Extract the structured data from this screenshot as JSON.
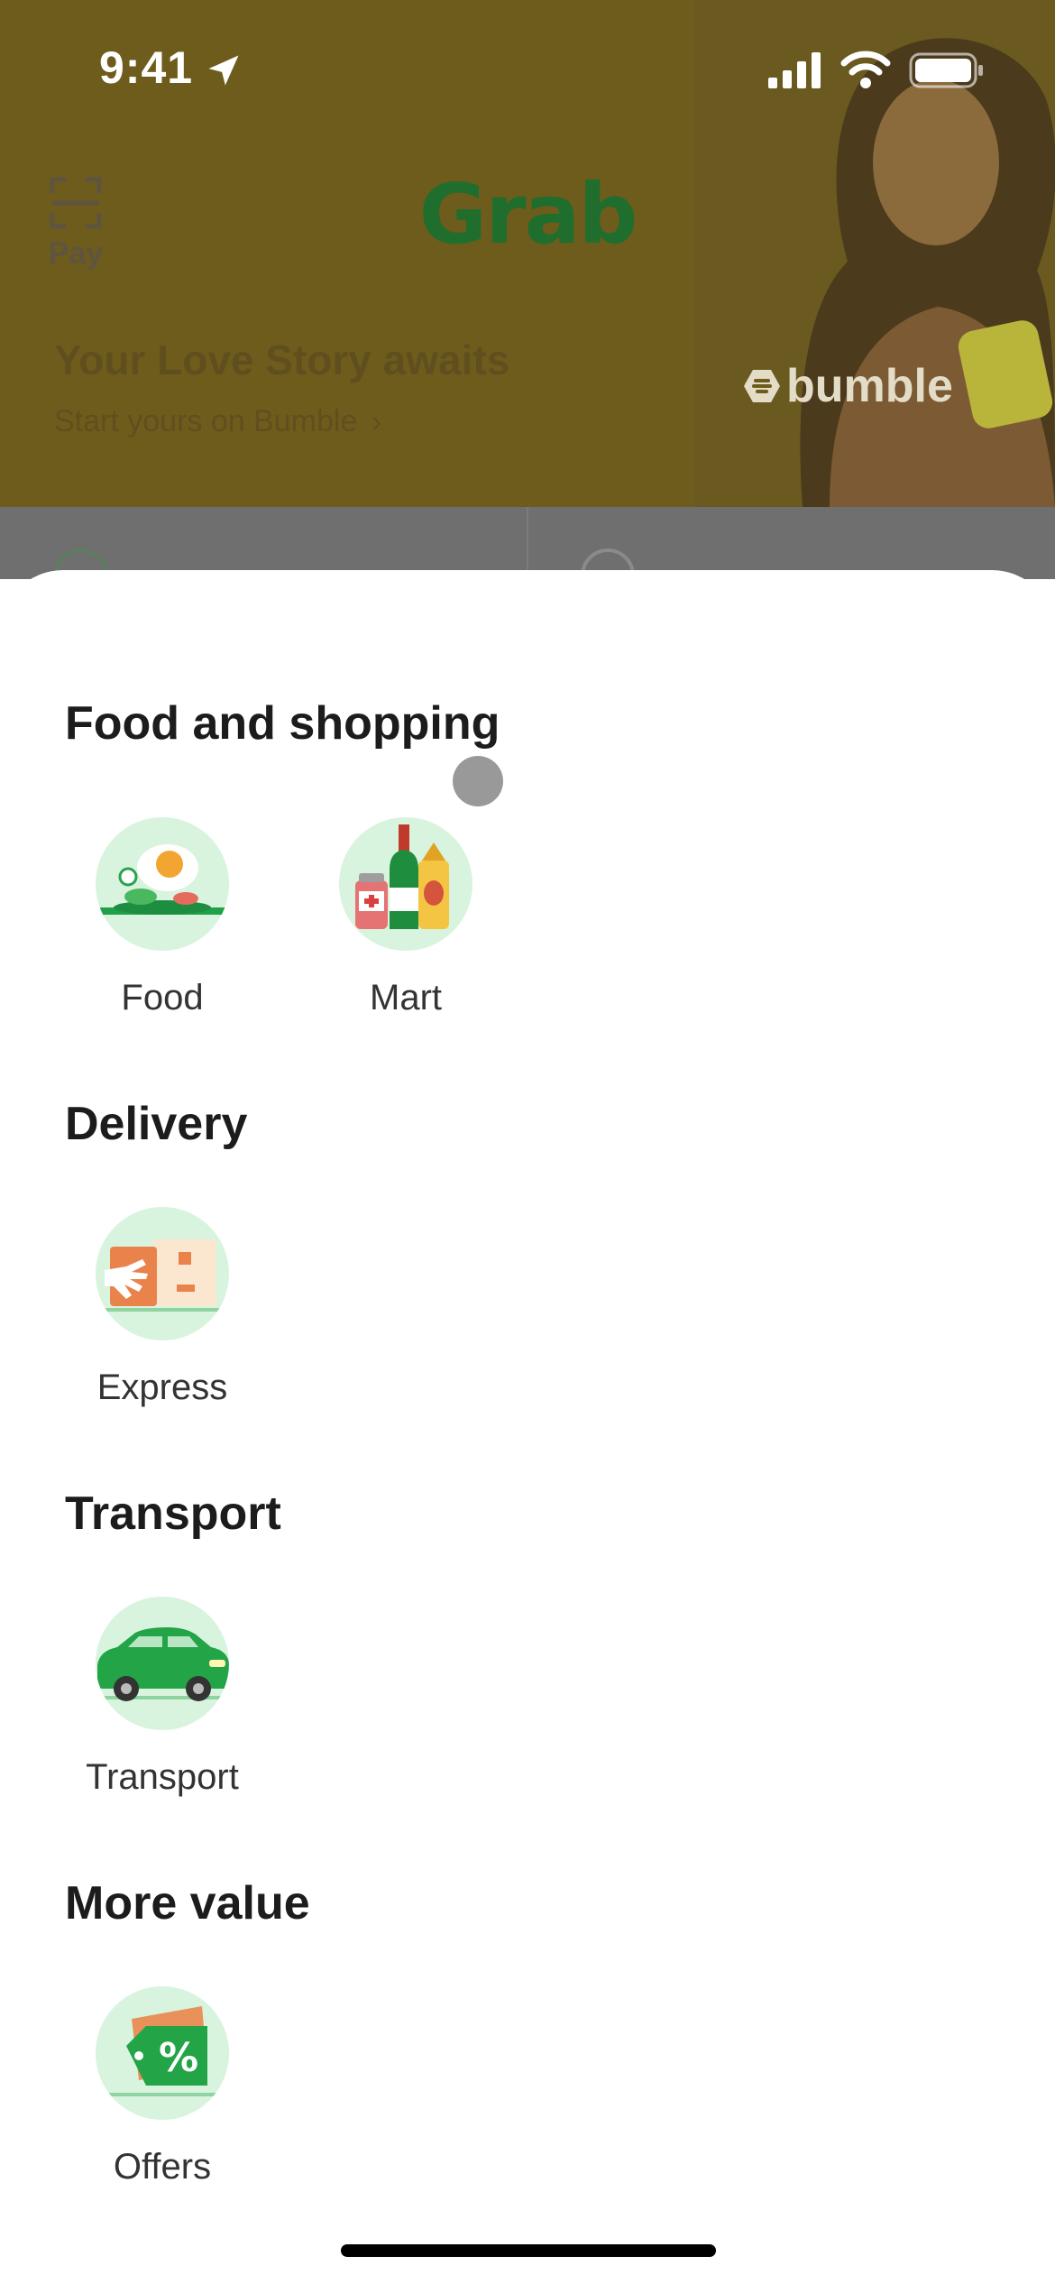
{
  "status_bar": {
    "time": "9:41"
  },
  "header": {
    "pay_label": "Pay",
    "brand": "Grab"
  },
  "promo": {
    "title": "Your Love Story awaits",
    "link_text": "Start yours on Bumble",
    "link_chevron": "›",
    "partner_logo": "bumble"
  },
  "sheet": {
    "sections": [
      {
        "title": "Food and shopping",
        "tiles": [
          {
            "label": "Food",
            "icon": "food-icon"
          },
          {
            "label": "Mart",
            "icon": "mart-icon"
          }
        ]
      },
      {
        "title": "Delivery",
        "tiles": [
          {
            "label": "Express",
            "icon": "express-icon"
          }
        ]
      },
      {
        "title": "Transport",
        "tiles": [
          {
            "label": "Transport",
            "icon": "car-icon"
          }
        ]
      },
      {
        "title": "More value",
        "tiles": [
          {
            "label": "Offers",
            "icon": "offers-icon"
          }
        ]
      }
    ]
  },
  "colors": {
    "hero_dim": "#6e5c1c",
    "brand_green": "#00b14f",
    "tile_bg": "#d8f4de",
    "sheet_bg": "#ffffff"
  }
}
